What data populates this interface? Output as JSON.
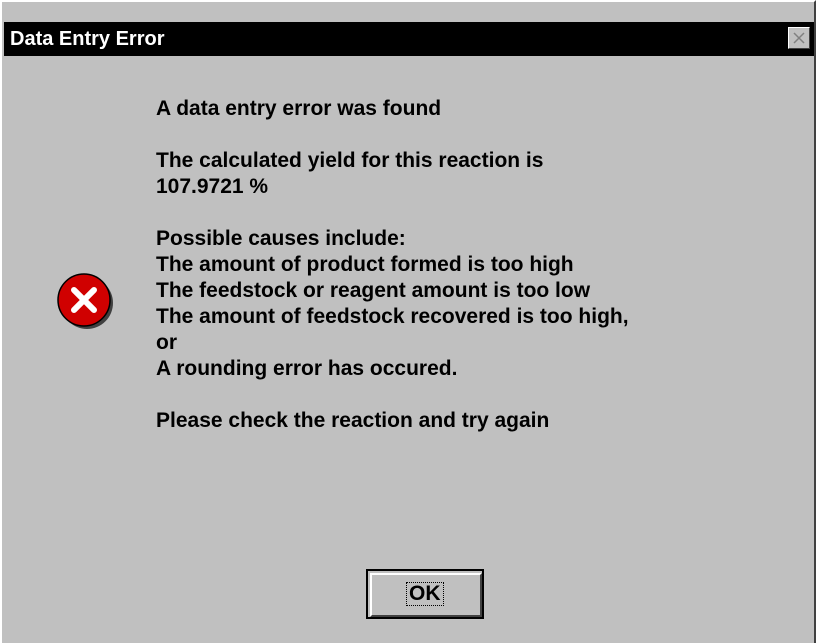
{
  "window": {
    "title": "Data Entry Error",
    "close_icon": "close-icon"
  },
  "icon": {
    "name": "error-icon",
    "color": "#d00000"
  },
  "message": {
    "headline": "A data entry error was found",
    "yield_line1": "The calculated yield for this reaction is",
    "yield_line2": "107.9721 %",
    "causes_header": "Possible causes include:",
    "causes": [
      "The amount of product formed is too high",
      "The feedstock or reagent amount is too low",
      "The amount of feedstock recovered is too high,",
      "or",
      "A rounding error has occured."
    ],
    "instruction": "Please check the reaction and try again"
  },
  "buttons": {
    "ok_label": "OK"
  }
}
